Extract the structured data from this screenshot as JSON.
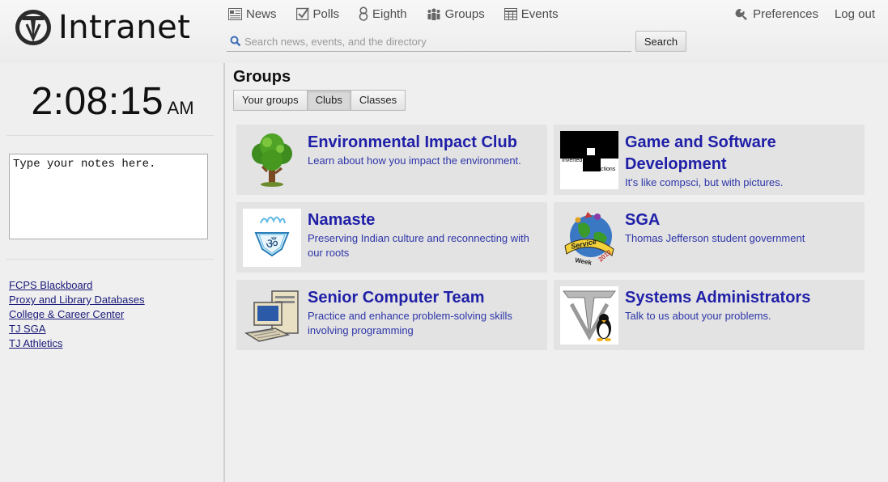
{
  "header": {
    "logo_text": "Intranet",
    "nav": [
      {
        "label": "News",
        "icon": "news-icon"
      },
      {
        "label": "Polls",
        "icon": "polls-icon"
      },
      {
        "label": "Eighth",
        "icon": "eighth-icon"
      },
      {
        "label": "Groups",
        "icon": "groups-icon"
      },
      {
        "label": "Events",
        "icon": "events-icon"
      }
    ],
    "preferences_label": "Preferences",
    "logout_label": "Log out",
    "search_placeholder": "Search news, events, and the directory",
    "search_button": "Search"
  },
  "sidebar": {
    "clock_time": "2:08:15",
    "clock_ampm": "AM",
    "notes_value": "Type your notes here.",
    "links": [
      "FCPS Blackboard",
      "Proxy and Library Databases",
      "College & Career Center",
      "TJ SGA",
      "TJ Athletics"
    ]
  },
  "main": {
    "title": "Groups",
    "tabs": [
      {
        "label": "Your groups",
        "active": false
      },
      {
        "label": "Clubs",
        "active": true
      },
      {
        "label": "Classes",
        "active": false
      }
    ],
    "groups": [
      {
        "title": "Environmental Impact Club",
        "desc": "Learn about how you impact the environment.",
        "icon": "tree-icon"
      },
      {
        "title": "Game and Software Development",
        "desc": "It's like compsci, but with pictures.",
        "icon": "inverted-productions-logo",
        "logo_text": [
          "Inverted",
          "P",
          "roductions"
        ]
      },
      {
        "title": "Namaste",
        "desc": "Preserving Indian culture and reconnecting with our roots",
        "icon": "om-icon"
      },
      {
        "title": "SGA",
        "desc": "Thomas Jefferson student government",
        "icon": "service-week-globe-icon",
        "logo_text": [
          "Service",
          "Week",
          "2012"
        ]
      },
      {
        "title": "Senior Computer Team",
        "desc": "Practice and enhance problem-solving skills involving programming",
        "icon": "computer-icon"
      },
      {
        "title": "Systems Administrators",
        "desc": "Talk to us about your problems.",
        "icon": "tux-logo-icon"
      }
    ]
  },
  "colors": {
    "link_title": "#1f1fa8",
    "card_bg": "#e3e3e3",
    "page_bg": "#efefef"
  }
}
